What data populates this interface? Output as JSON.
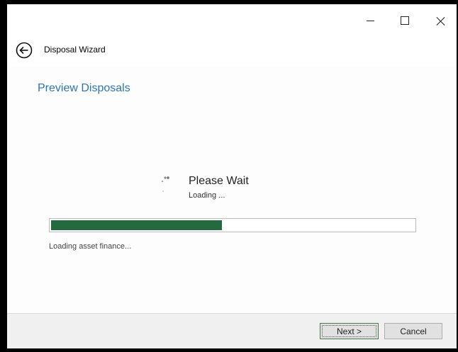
{
  "window": {
    "controls": [
      "minimize",
      "maximize",
      "close"
    ]
  },
  "header": {
    "title": "Disposal Wizard",
    "back_icon": "back-arrow-circle-icon"
  },
  "page": {
    "title": "Preview Disposals"
  },
  "loading": {
    "title": "Please Wait",
    "subtitle": "Loading ...",
    "progress_fraction": 0.47,
    "status": "Loading asset finance..."
  },
  "footer": {
    "next_label": "Next >",
    "cancel_label": "Cancel"
  },
  "colors": {
    "accent_title": "#2e75b6",
    "progress_fill": "#256a3f"
  }
}
